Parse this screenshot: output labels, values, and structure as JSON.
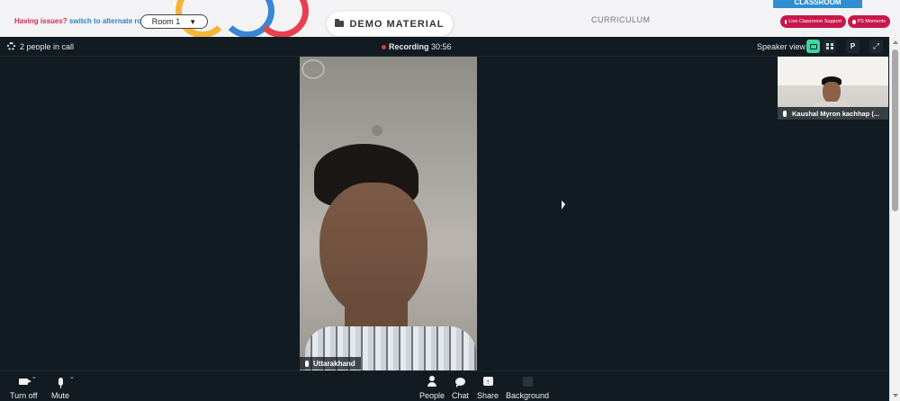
{
  "header": {
    "issues_text": "Having issues?",
    "alternate_link": "switch to alternate room",
    "room_value": "Room 1",
    "demo_material": "DEMO MATERIAL",
    "curriculum": "CURRICULUM",
    "classroom_tab": "CLASSROOM",
    "support_pill": "Live Classroom Support",
    "moments_pill": "PS Moments"
  },
  "call": {
    "people_count": "2 people in call",
    "recording_label": "Recording",
    "recording_time": "30:56",
    "view_label": "Speaker view",
    "p_button": "P",
    "main_participant": "Uttarakhand",
    "thumb_participant": "Kaushal Myron kachhap (..."
  },
  "controls": {
    "camera": "Turn off",
    "mute": "Mute",
    "people": "People",
    "chat": "Chat",
    "share": "Share",
    "background": "Background"
  },
  "colors": {
    "call_bg": "#111b21",
    "accent_green": "#3dd6a2",
    "pill_red": "#c8184b",
    "link_blue": "#2f84c4",
    "issues_red": "#d42c50"
  }
}
